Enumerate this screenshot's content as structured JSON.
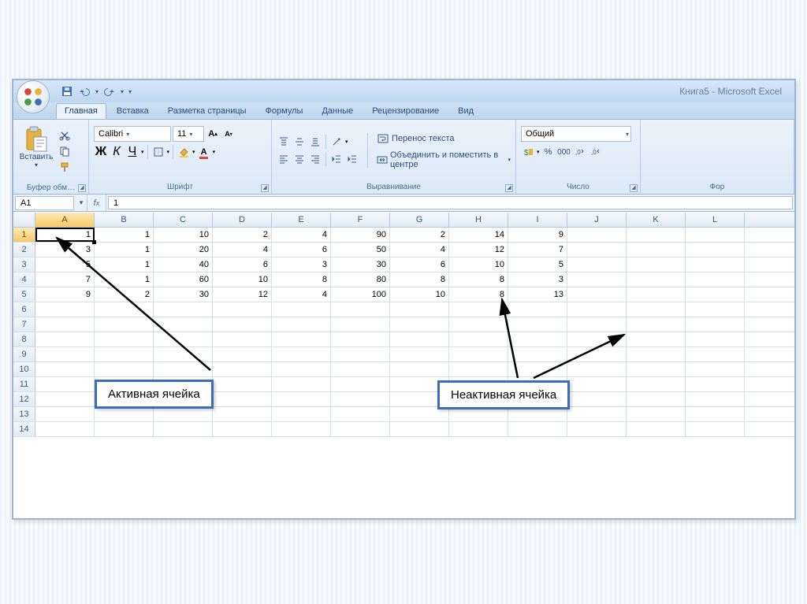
{
  "window": {
    "title": "Книга5 - Microsoft Excel"
  },
  "tabs": [
    "Главная",
    "Вставка",
    "Разметка страницы",
    "Формулы",
    "Данные",
    "Рецензирование",
    "Вид"
  ],
  "activeTab": 0,
  "ribbon": {
    "clipboard": {
      "paste": "Вставить",
      "label": "Буфер обм…"
    },
    "font": {
      "family": "Calibri",
      "size": "11",
      "label": "Шрифт",
      "bold": "Ж",
      "italic": "К",
      "underline": "Ч"
    },
    "alignment": {
      "wrap": "Перенос текста",
      "merge": "Объединить и поместить в центре",
      "label": "Выравнивание"
    },
    "number": {
      "format": "Общий",
      "label": "Число"
    },
    "styles_fragment": "Фор"
  },
  "namebox": "A1",
  "formula": "1",
  "columns": [
    "A",
    "B",
    "C",
    "D",
    "E",
    "F",
    "G",
    "H",
    "I",
    "J",
    "K",
    "L"
  ],
  "activeCol": 0,
  "rowCount": 14,
  "activeRow": 0,
  "selectedCell": {
    "r": 0,
    "c": 0
  },
  "chart_data": {
    "type": "table",
    "columns": [
      "A",
      "B",
      "C",
      "D",
      "E",
      "F",
      "G",
      "H",
      "I"
    ],
    "rows": [
      [
        1,
        1,
        10,
        2,
        4,
        90,
        2,
        14,
        9
      ],
      [
        3,
        1,
        20,
        4,
        6,
        50,
        4,
        12,
        7
      ],
      [
        5,
        1,
        40,
        6,
        3,
        30,
        6,
        10,
        5
      ],
      [
        7,
        1,
        60,
        10,
        8,
        80,
        8,
        8,
        3
      ],
      [
        9,
        2,
        30,
        12,
        4,
        100,
        10,
        8,
        13
      ]
    ]
  },
  "annotations": {
    "active_cell": "Активная ячейка",
    "inactive_cell": "Неактивная ячейка"
  }
}
